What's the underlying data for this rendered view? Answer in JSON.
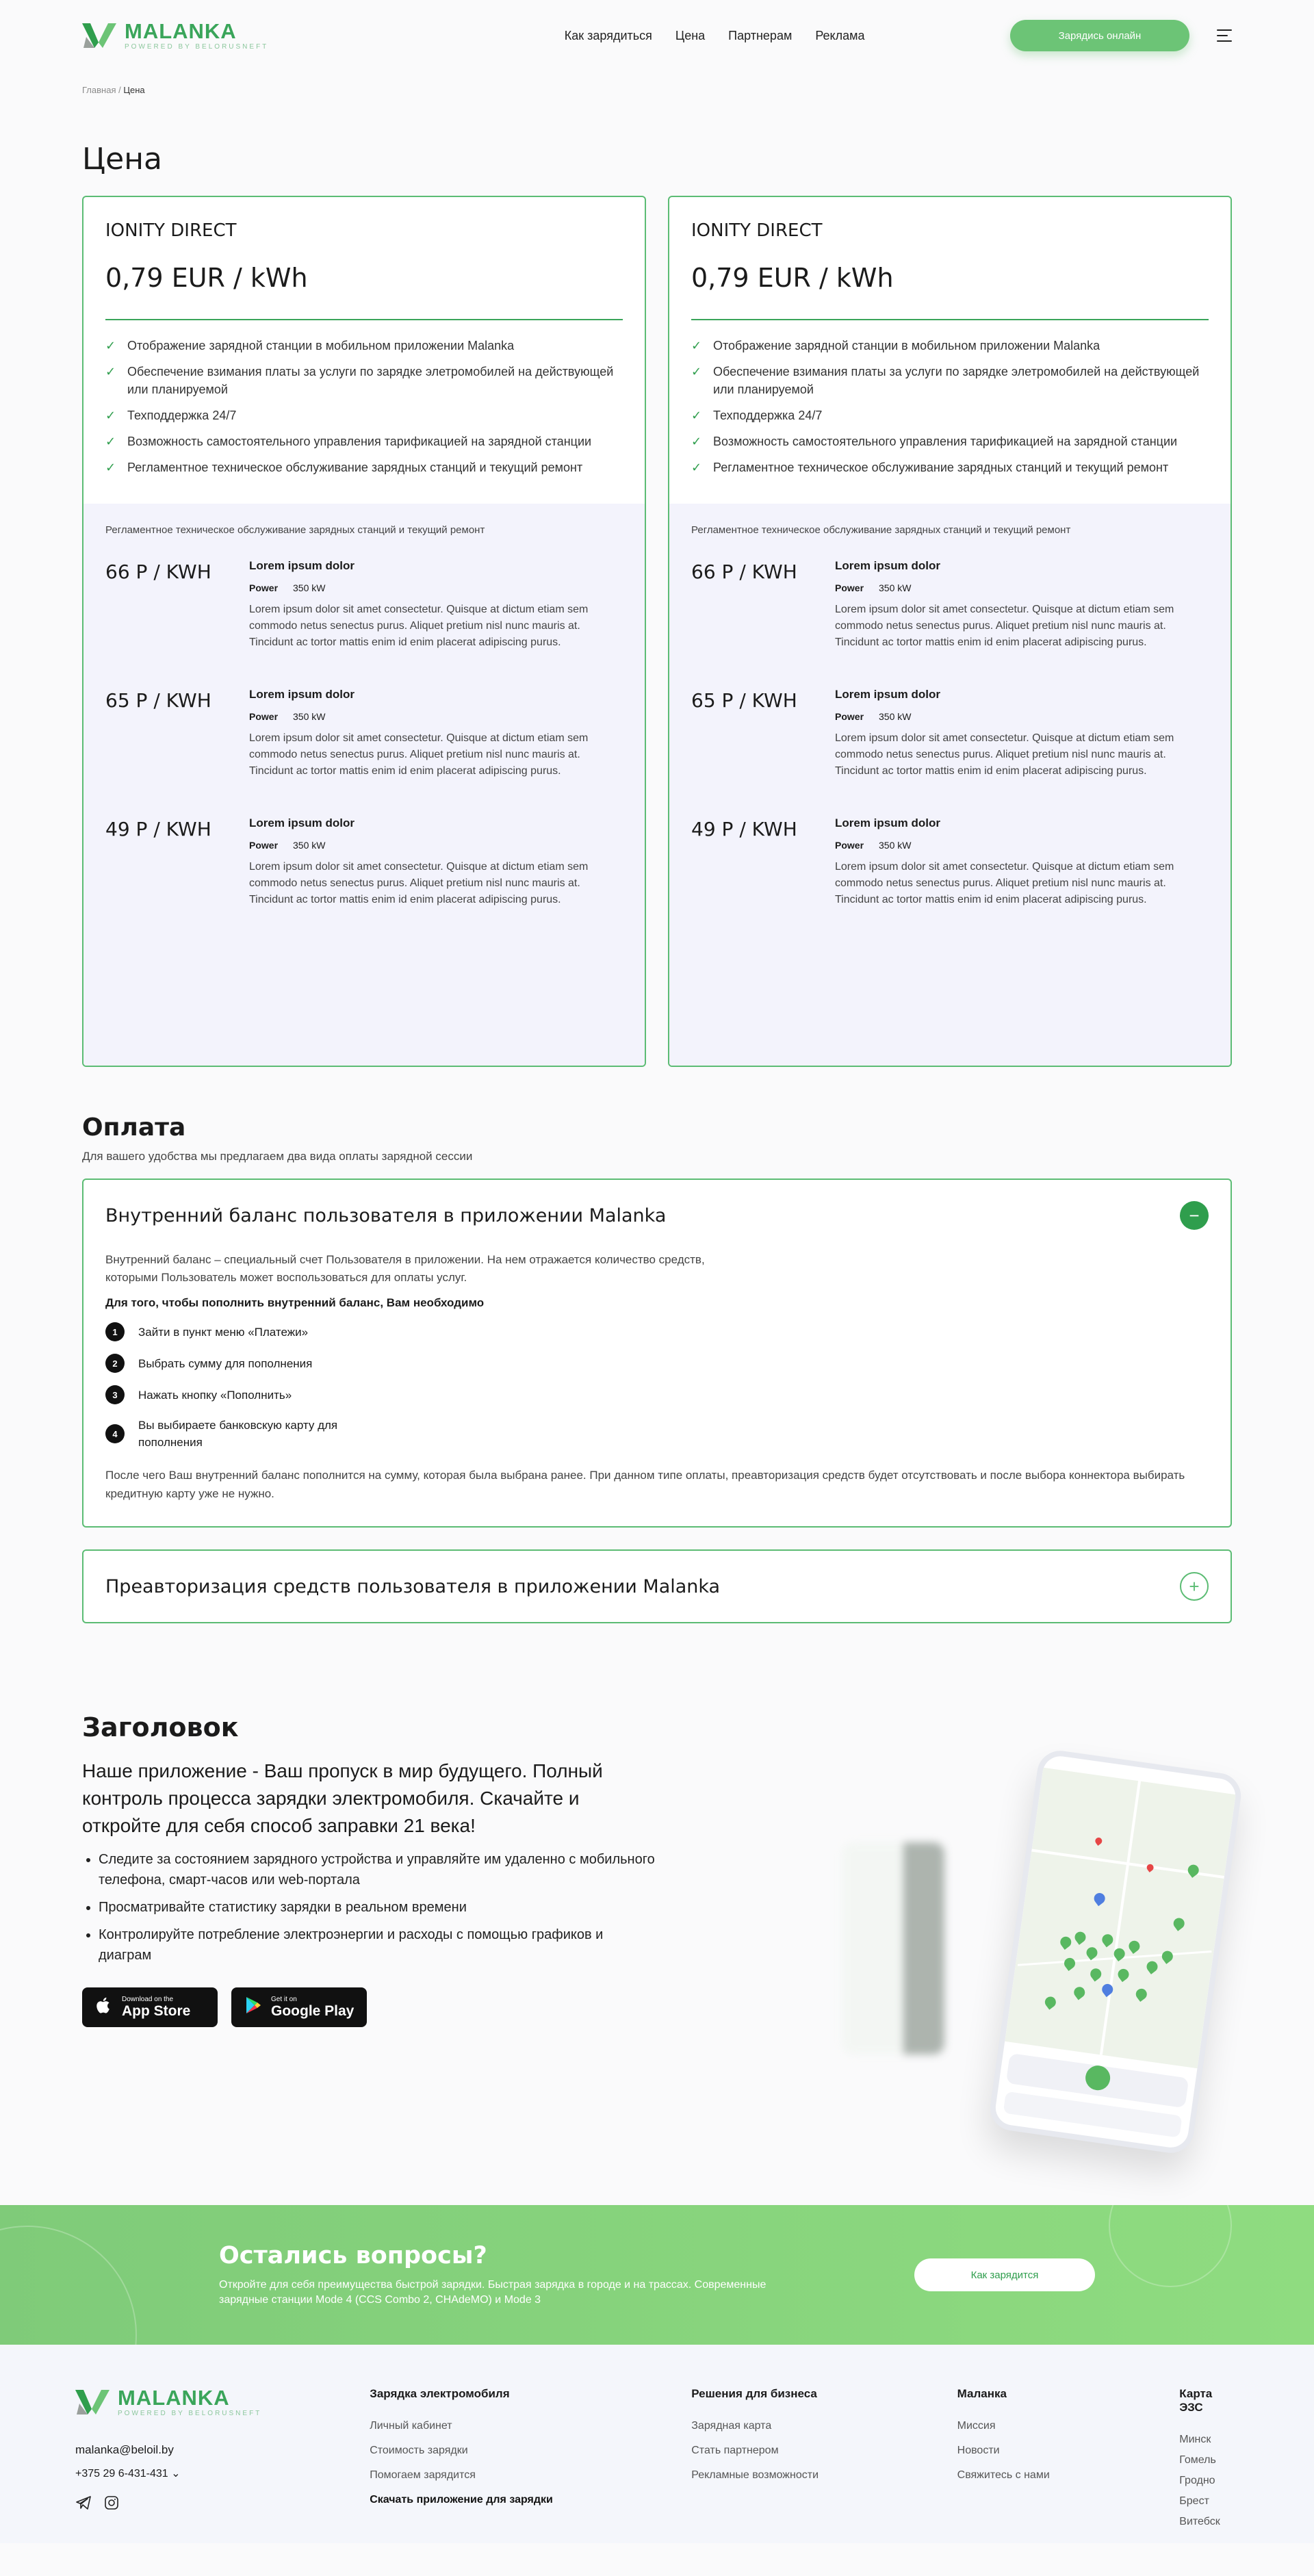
{
  "brand": {
    "name": "MALANKA",
    "tagline": "POWERED BY BELORUSNEFT"
  },
  "nav": [
    "Как зарядиться",
    "Цена",
    "Партнерам",
    "Реклама"
  ],
  "header": {
    "cta": "Зарядись онлайн"
  },
  "breadcrumbs": {
    "home": "Главная",
    "sep": "/",
    "current": "Цена"
  },
  "page_title": "Цена",
  "cards": [
    {
      "name": "IONITY DIRECT",
      "price": "0,79 EUR / kWh",
      "features": [
        "Отображение зарядной станции в мобильном приложении Malanka",
        "Обеспечение взимания платы за услуги по зарядке элетромобилей на действующей или планируемой",
        "Техподдержка 24/7",
        "Возможность самостоятельного управления тарификацией на зарядной станции",
        "Регламентное техническое обслуживание зарядных станций и текущий ремонт"
      ],
      "note": "Регламентное техническое обслуживание зарядных станций и текущий ремонт",
      "rates": [
        {
          "price": "66 Р / KWH",
          "title": "Lorem ipsum dolor",
          "power_label": "Power",
          "power": "350 kW",
          "desc": "Lorem ipsum dolor sit amet consectetur. Quisque at dictum etiam sem commodo netus senectus purus. Aliquet pretium nisl nunc mauris at. Tincidunt ac tortor mattis enim id enim placerat adipiscing purus."
        },
        {
          "price": "65 Р / KWH",
          "title": "Lorem ipsum dolor",
          "power_label": "Power",
          "power": "350 kW",
          "desc": "Lorem ipsum dolor sit amet consectetur. Quisque at dictum etiam sem commodo netus senectus purus. Aliquet pretium nisl nunc mauris at. Tincidunt ac tortor mattis enim id enim placerat adipiscing purus."
        },
        {
          "price": "49 Р / KWH",
          "title": "Lorem ipsum dolor",
          "power_label": "Power",
          "power": "350 kW",
          "desc": "Lorem ipsum dolor sit amet consectetur. Quisque at dictum etiam sem commodo netus senectus purus. Aliquet pretium nisl nunc mauris at. Tincidunt ac tortor mattis enim id enim placerat adipiscing purus."
        }
      ]
    },
    {
      "name": "IONITY DIRECT",
      "price": "0,79 EUR / kWh",
      "features": [
        "Отображение зарядной станции в мобильном приложении Malanka",
        "Обеспечение взимания платы за услуги по зарядке элетромобилей на действующей или планируемой",
        "Техподдержка 24/7",
        "Возможность самостоятельного управления тарификацией на зарядной станции",
        "Регламентное техническое обслуживание зарядных станций и текущий ремонт"
      ],
      "note": "Регламентное техническое обслуживание зарядных станций и текущий ремонт",
      "rates": [
        {
          "price": "66 Р / KWH",
          "title": "Lorem ipsum dolor",
          "power_label": "Power",
          "power": "350 kW",
          "desc": "Lorem ipsum dolor sit amet consectetur. Quisque at dictum etiam sem commodo netus senectus purus. Aliquet pretium nisl nunc mauris at. Tincidunt ac tortor mattis enim id enim placerat adipiscing purus."
        },
        {
          "price": "65 Р / KWH",
          "title": "Lorem ipsum dolor",
          "power_label": "Power",
          "power": "350 kW",
          "desc": "Lorem ipsum dolor sit amet consectetur. Quisque at dictum etiam sem commodo netus senectus purus. Aliquet pretium nisl nunc mauris at. Tincidunt ac tortor mattis enim id enim placerat adipiscing purus."
        },
        {
          "price": "49 Р / KWH",
          "title": "Lorem ipsum dolor",
          "power_label": "Power",
          "power": "350 kW",
          "desc": "Lorem ipsum dolor sit amet consectetur. Quisque at dictum etiam sem commodo netus senectus purus. Aliquet pretium nisl nunc mauris at. Tincidunt ac tortor mattis enim id enim placerat adipiscing purus."
        }
      ]
    }
  ],
  "payment": {
    "title": "Оплата",
    "subtitle": "Для вашего удобства мы предлагаем два вида оплаты зарядной сессии",
    "acc1": {
      "title": "Внутренний баланс пользователя в приложении Malanka",
      "toggle": "−",
      "intro": "Внутренний баланс – специальный счет Пользователя в приложении. На нем отражается количество средств, которыми Пользователь может воспользоваться для оплаты услуг.",
      "lead": "Для того, чтобы пополнить внутренний баланс, Вам необходимо",
      "steps": [
        {
          "n": "1",
          "text": "Зайти в пункт меню «Платежи»"
        },
        {
          "n": "2",
          "text": "Выбрать сумму для пополнения"
        },
        {
          "n": "3",
          "text": "Нажать кнопку «Пополнить»"
        },
        {
          "n": "4",
          "text": "Вы выбираете банковскую карту для пополнения"
        }
      ],
      "after": "После чего Ваш внутренний баланс пополнится на сумму, которая была выбрана ранее. При данном типе оплаты, преавторизация средств будет отсутствовать и после выбора коннектора выбирать кредитную карту уже не нужно."
    },
    "acc2": {
      "title": "Преавторизация средств пользователя в приложении Malanka",
      "toggle": "+"
    }
  },
  "promo": {
    "title": "Заголовок",
    "lead": "Наше приложение - Ваш пропуск в мир будущего. Полный контроль процесса зарядки электромобиля. Скачайте и откройте для себя способ заправки 21 века!",
    "bullets": [
      "Следите за состоянием зарядного устройства и управляйте им удаленно с мобильного телефона, смарт-часов или web-портала",
      "Просматривайте статистику зарядки в реальном времени",
      "Контролируйте потребление электроэнергии и расходы с помощью графиков и диаграм"
    ],
    "appstore": {
      "small": "Download on the",
      "big": "App Store"
    },
    "googleplay": {
      "small": "Get it on",
      "big": "Google Play"
    }
  },
  "cta": {
    "title": "Остались вопросы?",
    "text": "Откройте для себя преимущества быстрой зарядки. Быстрая зарядка в городе и на трассах. Современные зарядные станции Mode 4 (CCS Combo 2, CHAdeMO) и Mode 3",
    "button": "Как зарядится"
  },
  "footer": {
    "email": "malanka@beloil.by",
    "phone": "+375 29 6-431-431",
    "cols": [
      {
        "title": "Зарядка электромобиля",
        "links": [
          "Личный кабинет",
          "Стоимость зарядки",
          "Помогаем зарядится"
        ],
        "bold": "Скачать приложение для зарядки"
      },
      {
        "title": "Решения для бизнеса",
        "links": [
          "Зарядная карта",
          "Стать партнером",
          "Рекламные возможности"
        ]
      },
      {
        "title": "Маланка",
        "links": [
          "Миссия",
          "Новости",
          "Свяжитесь с нами"
        ]
      },
      {
        "title": "Карта ЭЗС",
        "links": [
          "Минск",
          "Гомель",
          "Гродно",
          "Брест",
          "Витебск"
        ]
      }
    ]
  },
  "colors": {
    "accent": "#3aa55a",
    "card_border": "#5cbc74",
    "rate_bg": "#f3f3fc",
    "cta_bg": "#8fdc80"
  }
}
